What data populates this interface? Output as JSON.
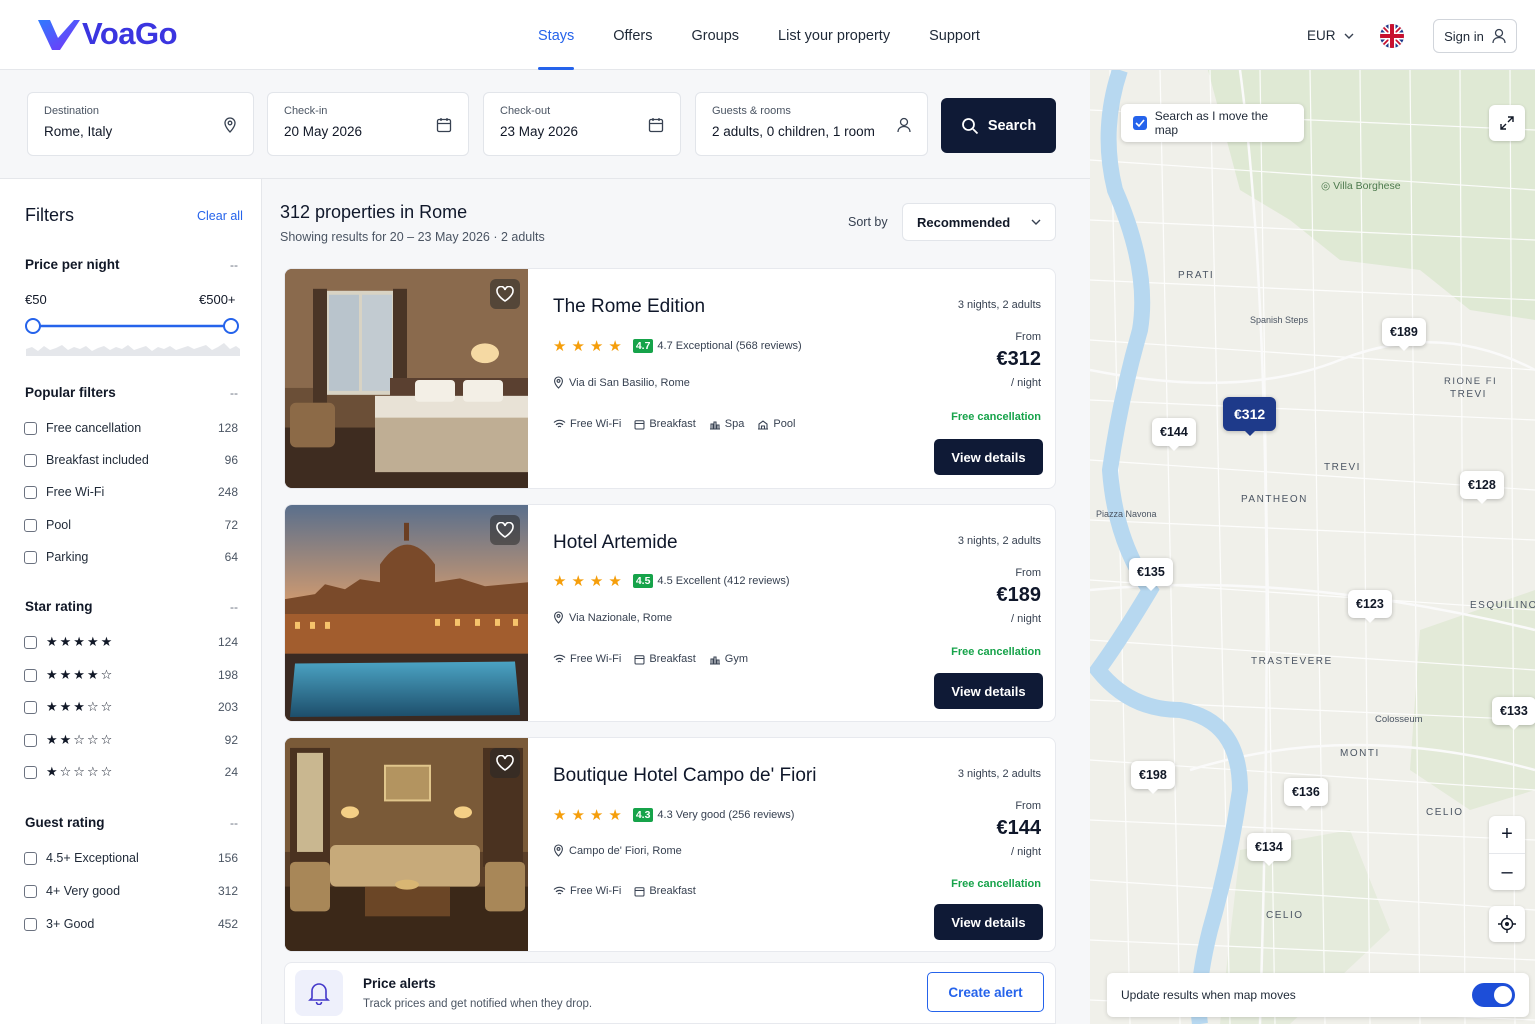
{
  "brand": {
    "name": "VoaGo"
  },
  "nav": {
    "items": [
      {
        "label": "Stays"
      },
      {
        "label": "Offers"
      },
      {
        "label": "Groups"
      },
      {
        "label": "List your property"
      },
      {
        "label": "Support"
      }
    ]
  },
  "header": {
    "currency": "EUR",
    "signin": "Sign in"
  },
  "search": {
    "destination": {
      "label": "Destination",
      "value": "Rome, Italy"
    },
    "checkin": {
      "label": "Check-in",
      "value": "20 May 2026"
    },
    "checkout": {
      "label": "Check-out",
      "value": "23 May 2026"
    },
    "guests": {
      "label": "Guests & rooms",
      "value": "2 adults, 0 children, 1 room"
    },
    "button": "Search"
  },
  "filters": {
    "title": "Filters",
    "clear": "Clear all",
    "collapse": "--",
    "price": {
      "title": "Price per night",
      "min": "€50",
      "max": "€500+"
    },
    "popular": {
      "title": "Popular filters",
      "items": [
        {
          "label": "Free cancellation",
          "count": "128"
        },
        {
          "label": "Breakfast included",
          "count": "96"
        },
        {
          "label": "Free Wi-Fi",
          "count": "248"
        },
        {
          "label": "Pool",
          "count": "72"
        },
        {
          "label": "Parking",
          "count": "64"
        }
      ]
    },
    "stars": {
      "title": "Star rating",
      "items": [
        {
          "stars": "★★★★★",
          "count": "124"
        },
        {
          "stars": "★★★★☆",
          "count": "198"
        },
        {
          "stars": "★★★☆☆",
          "count": "203"
        },
        {
          "stars": "★★☆☆☆",
          "count": "92"
        },
        {
          "stars": "★☆☆☆☆",
          "count": "24"
        }
      ]
    },
    "guest": {
      "title": "Guest rating",
      "items": [
        {
          "label": "4.5+ Exceptional",
          "count": "156"
        },
        {
          "label": "4+ Very good",
          "count": "312"
        },
        {
          "label": "3+ Good",
          "count": "452"
        }
      ]
    }
  },
  "results": {
    "title": "312 properties in Rome",
    "subtitle": "Showing results for 20 – 23 May 2026 · 2 adults",
    "sort_label": "Sort by",
    "sort_value": "Recommended"
  },
  "hotels": [
    {
      "name": "The Rome Edition",
      "score": "4.7",
      "rating": "4.7 Exceptional (568 reviews)",
      "address": "Via di San Basilio, Rome",
      "amenities": [
        "Free Wi-Fi",
        "Breakfast",
        "Spa",
        "Pool"
      ],
      "nights": "3 nights, 2 adults",
      "from": "From",
      "price": "€312",
      "per": "/ night",
      "cancel": "Free cancellation",
      "button": "View details"
    },
    {
      "name": "Hotel Artemide",
      "score": "4.5",
      "rating": "4.5 Excellent (412 reviews)",
      "address": "Via Nazionale, Rome",
      "amenities": [
        "Free Wi-Fi",
        "Breakfast",
        "Gym"
      ],
      "nights": "3 nights, 2 adults",
      "from": "From",
      "price": "€189",
      "per": "/ night",
      "cancel": "Free cancellation",
      "button": "View details"
    },
    {
      "name": "Boutique Hotel Campo de' Fiori",
      "score": "4.3",
      "rating": "4.3 Very good (256 reviews)",
      "address": "Campo de' Fiori, Rome",
      "amenities": [
        "Free Wi-Fi",
        "Breakfast"
      ],
      "nights": "3 nights, 2 adults",
      "from": "From",
      "price": "€144",
      "per": "/ night",
      "cancel": "Free cancellation",
      "button": "View details"
    }
  ],
  "alert": {
    "title": "Price alerts",
    "text": "Track prices and get notified when they drop.",
    "button": "Create alert"
  },
  "map": {
    "search_move": "Search as I move the map",
    "update_label": "Update results when map moves",
    "places": {
      "villa": "Villa Borghese",
      "prati": "PRATI",
      "spanish": "Spanish Steps",
      "rione": "RIONE FI",
      "trevi_top": "TREVI",
      "trevi": "TREVI",
      "pantheon": "PANTHEON",
      "navona": "Piazza Navona",
      "esquilino": "ESQUILINO",
      "trastevere": "TRASTEVERE",
      "colosseum": "Colosseum",
      "monti": "MONTI",
      "celio": "CELIO",
      "celio2": "CELIO"
    },
    "pins": {
      "p1": "€189",
      "p2": "€312",
      "p3": "€144",
      "p4": "€128",
      "p5": "€135",
      "p6": "€123",
      "p7": "€133",
      "p8": "€198",
      "p9": "€136",
      "p10": "€134"
    }
  },
  "colors": {
    "brand": "#3b35e0",
    "primary": "#0f1a36",
    "accent": "#2563eb",
    "success": "#16a34a",
    "star": "#f59e0b"
  }
}
